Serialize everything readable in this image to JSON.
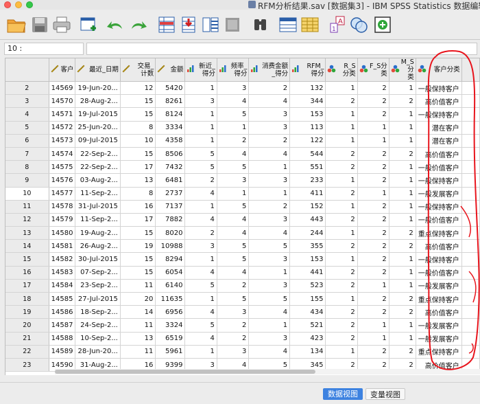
{
  "window": {
    "title": "RFM分析结果.sav [数据集3] - IBM SPSS Statistics 数据编辑器"
  },
  "toolbar": {
    "icons": [
      "open-folder-icon",
      "save-icon",
      "print-icon",
      "recall-dialog-icon",
      "undo-icon",
      "redo-icon",
      "goto-case-icon",
      "goto-variable-icon",
      "variables-icon",
      "run-descriptives-icon",
      "find-icon",
      "insert-cases-icon",
      "insert-variable-icon",
      "split-file-icon",
      "weight-cases-icon",
      "select-cases-icon",
      "value-labels-icon"
    ]
  },
  "cell_editor": {
    "reference": "10 :",
    "value": ""
  },
  "grid": {
    "columns": [
      {
        "label": "客户",
        "icon": "scale"
      },
      {
        "label": "最近_日期",
        "icon": "scale"
      },
      {
        "label": "交易_计数",
        "icon": "scale"
      },
      {
        "label": "金额",
        "icon": "scale"
      },
      {
        "label": "新近_得分",
        "icon": "ordinal"
      },
      {
        "label": "频率_得分",
        "icon": "ordinal"
      },
      {
        "label": "消费金额_得分",
        "icon": "ordinal"
      },
      {
        "label": "RFM_得分",
        "icon": "ordinal"
      },
      {
        "label": "R_S分类",
        "icon": "nominal"
      },
      {
        "label": "F_S分类",
        "icon": "nominal"
      },
      {
        "label": "M_S分类",
        "icon": "nominal"
      },
      {
        "label": "客户分类",
        "icon": "nominal"
      }
    ],
    "rows": [
      {
        "n": "2",
        "c": [
          "14569",
          "19-Jun-20...",
          "12",
          "5420",
          "1",
          "3",
          "2",
          "132",
          "1",
          "2",
          "1",
          "一般保持客户"
        ]
      },
      {
        "n": "3",
        "c": [
          "14570",
          "28-Aug-2...",
          "15",
          "8261",
          "3",
          "4",
          "4",
          "344",
          "2",
          "2",
          "2",
          "高价值客户"
        ]
      },
      {
        "n": "4",
        "c": [
          "14571",
          "19-Jul-2015",
          "15",
          "8124",
          "1",
          "5",
          "3",
          "153",
          "1",
          "2",
          "1",
          "一般保持客户"
        ]
      },
      {
        "n": "5",
        "c": [
          "14572",
          "25-Jun-20...",
          "8",
          "3334",
          "1",
          "1",
          "3",
          "113",
          "1",
          "1",
          "1",
          "潜在客户"
        ]
      },
      {
        "n": "6",
        "c": [
          "14573",
          "09-Jul-2015",
          "10",
          "4358",
          "1",
          "2",
          "2",
          "122",
          "1",
          "1",
          "1",
          "潜在客户"
        ]
      },
      {
        "n": "7",
        "c": [
          "14574",
          "22-Sep-2...",
          "15",
          "8506",
          "5",
          "4",
          "4",
          "544",
          "2",
          "2",
          "2",
          "高价值客户"
        ]
      },
      {
        "n": "8",
        "c": [
          "14575",
          "22-Sep-2...",
          "17",
          "7432",
          "5",
          "5",
          "1",
          "551",
          "2",
          "2",
          "1",
          "一般价值客户"
        ]
      },
      {
        "n": "9",
        "c": [
          "14576",
          "03-Aug-2...",
          "13",
          "6481",
          "2",
          "3",
          "3",
          "233",
          "1",
          "2",
          "1",
          "一般保持客户"
        ]
      },
      {
        "n": "10",
        "c": [
          "14577",
          "11-Sep-2...",
          "8",
          "2737",
          "4",
          "1",
          "1",
          "411",
          "2",
          "1",
          "1",
          "一般发展客户"
        ]
      },
      {
        "n": "11",
        "c": [
          "14578",
          "31-Jul-2015",
          "16",
          "7137",
          "1",
          "5",
          "2",
          "152",
          "1",
          "2",
          "1",
          "一般保持客户"
        ]
      },
      {
        "n": "12",
        "c": [
          "14579",
          "11-Sep-2...",
          "17",
          "7882",
          "4",
          "4",
          "3",
          "443",
          "2",
          "2",
          "1",
          "一般价值客户"
        ]
      },
      {
        "n": "13",
        "c": [
          "14580",
          "19-Aug-2...",
          "15",
          "8020",
          "2",
          "4",
          "4",
          "244",
          "1",
          "2",
          "2",
          "重点保持客户"
        ]
      },
      {
        "n": "14",
        "c": [
          "14581",
          "26-Aug-2...",
          "19",
          "10988",
          "3",
          "5",
          "5",
          "355",
          "2",
          "2",
          "2",
          "高价值客户"
        ]
      },
      {
        "n": "15",
        "c": [
          "14582",
          "30-Jul-2015",
          "15",
          "8294",
          "1",
          "5",
          "3",
          "153",
          "1",
          "2",
          "1",
          "一般保持客户"
        ]
      },
      {
        "n": "16",
        "c": [
          "14583",
          "07-Sep-2...",
          "15",
          "6054",
          "4",
          "4",
          "1",
          "441",
          "2",
          "2",
          "1",
          "一般价值客户"
        ]
      },
      {
        "n": "17",
        "c": [
          "14584",
          "23-Sep-2...",
          "11",
          "6140",
          "5",
          "2",
          "3",
          "523",
          "2",
          "1",
          "1",
          "一般发展客户"
        ]
      },
      {
        "n": "18",
        "c": [
          "14585",
          "27-Jul-2015",
          "20",
          "11635",
          "1",
          "5",
          "5",
          "155",
          "1",
          "2",
          "2",
          "重点保持客户"
        ]
      },
      {
        "n": "19",
        "c": [
          "14586",
          "18-Sep-2...",
          "14",
          "6956",
          "4",
          "3",
          "4",
          "434",
          "2",
          "2",
          "2",
          "高价值客户"
        ]
      },
      {
        "n": "20",
        "c": [
          "14587",
          "24-Sep-2...",
          "11",
          "3324",
          "5",
          "2",
          "1",
          "521",
          "2",
          "1",
          "1",
          "一般发展客户"
        ]
      },
      {
        "n": "21",
        "c": [
          "14588",
          "10-Sep-2...",
          "13",
          "6519",
          "4",
          "2",
          "3",
          "423",
          "2",
          "1",
          "1",
          "一般发展客户"
        ]
      },
      {
        "n": "22",
        "c": [
          "14589",
          "28-Jun-20...",
          "11",
          "5961",
          "1",
          "3",
          "4",
          "134",
          "1",
          "2",
          "2",
          "重点保持客户"
        ]
      },
      {
        "n": "23",
        "c": [
          "14590",
          "31-Aug-2...",
          "16",
          "9399",
          "3",
          "4",
          "5",
          "345",
          "2",
          "2",
          "2",
          "高价值客户"
        ]
      }
    ],
    "selected_row": "10"
  },
  "tabs": {
    "data_view": "数据视图",
    "variable_view": "变量视图"
  },
  "colors": {
    "accent": "#3d82e0",
    "annotation": "#e8141c"
  }
}
